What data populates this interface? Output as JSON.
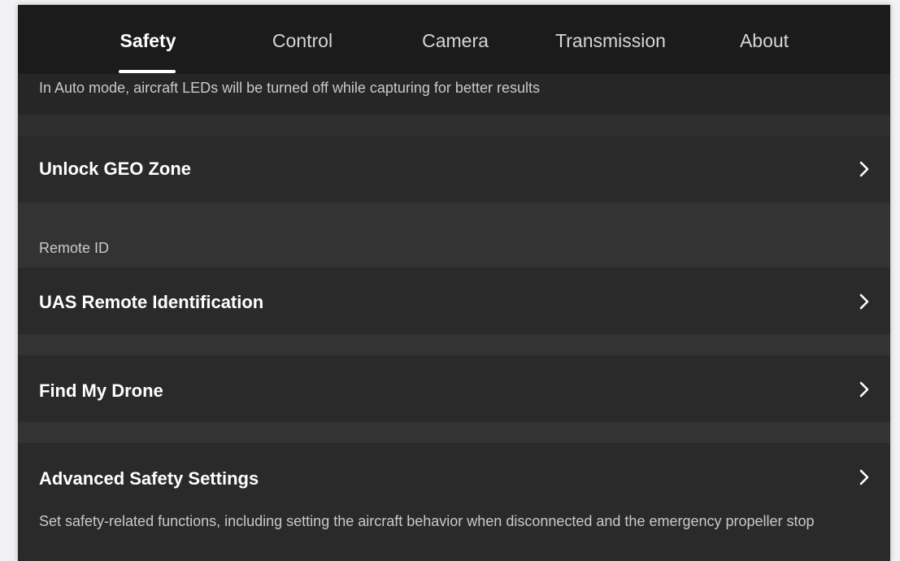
{
  "tabs": [
    {
      "label": "Safety",
      "active": true
    },
    {
      "label": "Control",
      "active": false
    },
    {
      "label": "Camera",
      "active": false
    },
    {
      "label": "Transmission",
      "active": false
    },
    {
      "label": "About",
      "active": false
    }
  ],
  "auto_mode_note": "In Auto mode, aircraft LEDs will be turned off while capturing for better results",
  "items": {
    "unlock_geo_zone": "Unlock GEO Zone",
    "remote_id_section": "Remote ID",
    "uas_remote_identification": "UAS Remote Identification",
    "find_my_drone": "Find My Drone",
    "advanced_safety_settings": "Advanced Safety Settings",
    "advanced_safety_description": "Set safety-related functions, including setting the aircraft behavior when disconnected and the emergency propeller stop"
  },
  "icons": {
    "row_arrow": "chevron-right-icon"
  },
  "colors": {
    "background": "#262626",
    "tab_bar": "#1b1b1b",
    "text_primary": "#ffffff",
    "text_secondary": "#c9c9c9"
  }
}
